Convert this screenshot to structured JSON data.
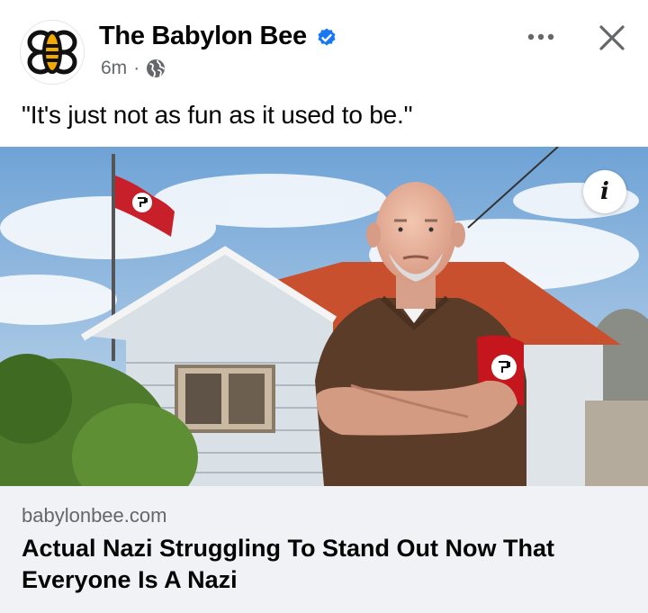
{
  "post": {
    "page_name": "The Babylon Bee",
    "timestamp": "6m",
    "separator": "·",
    "caption": "\"It's just not as fun as it used to be.\"",
    "verified_icon": "verified-badge-icon",
    "audience_icon": "globe-icon",
    "more_icon": "more-horizontal-icon",
    "close_icon": "close-icon"
  },
  "link_preview": {
    "info_label": "i",
    "domain": "babylonbee.com",
    "headline": "Actual Nazi Struggling To Stand Out Now That Everyone Is A Nazi"
  },
  "colors": {
    "verified": "#1877f2",
    "secondary_text": "#65676b",
    "footer_bg": "#f0f2f5"
  }
}
